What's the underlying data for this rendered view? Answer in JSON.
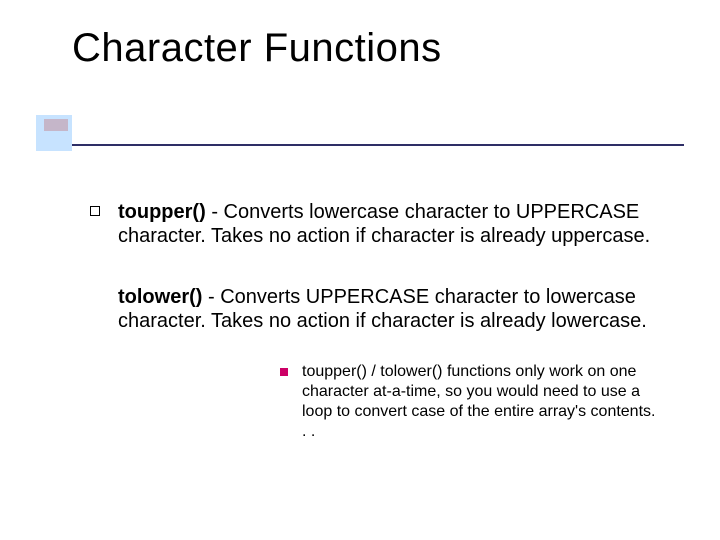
{
  "title": "Character Functions",
  "items": [
    {
      "fn": "toupper()",
      "sep": " - ",
      "desc": "Converts lowercase character to UPPERCASE character. Takes no action if character is already uppercase."
    },
    {
      "fn": "tolower()",
      "sep": " - ",
      "desc": "Converts UPPERCASE character to lowercase character. Takes no action if character is already lowercase."
    }
  ],
  "note": "toupper() / tolower() functions only work on one character at-a-time, so you would need to use a loop to convert case of the entire array's contents. . ."
}
